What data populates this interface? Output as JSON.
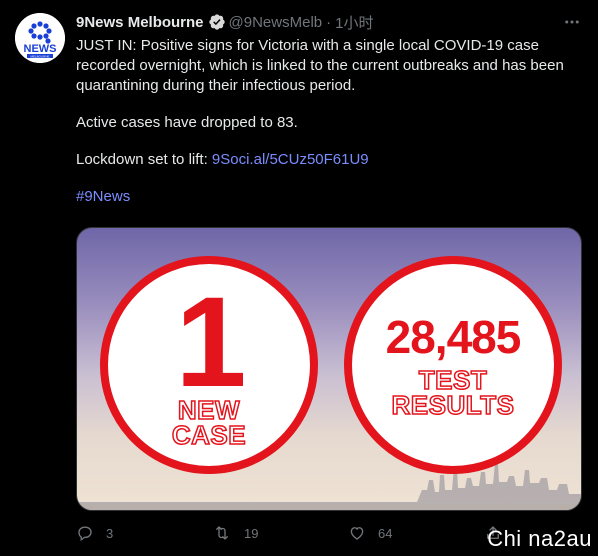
{
  "author": {
    "display_name": "9News Melbourne",
    "handle": "@9NewsMelb",
    "separator": "·",
    "time": "1小时",
    "avatar_text": "NEWS",
    "avatar_subtext": "MELBOURNE"
  },
  "tweet": {
    "line1": "JUST IN: Positive signs for Victoria with a single local COVID-19 case recorded overnight, which is linked to the current outbreaks and has been quarantining during their infectious period.",
    "line2": "Active cases have dropped to 83.",
    "line3_prefix": "Lockdown set to lift: ",
    "line3_link": "9Soci.al/5CUz50F61U9",
    "hashtag": "#9News"
  },
  "media": {
    "left_number": "1",
    "left_caption_1": "NEW",
    "left_caption_2": "CASE",
    "right_number": "28,485",
    "right_caption_1": "TEST",
    "right_caption_2": "RESULTS",
    "accent_color": "#e3141c"
  },
  "actions": {
    "reply_count": "3",
    "retweet_count": "19",
    "like_count": "64",
    "reply_icon": "reply-icon",
    "retweet_icon": "retweet-icon",
    "like_icon": "heart-icon",
    "share_icon": "share-icon"
  },
  "watermark": "Chi na2au"
}
